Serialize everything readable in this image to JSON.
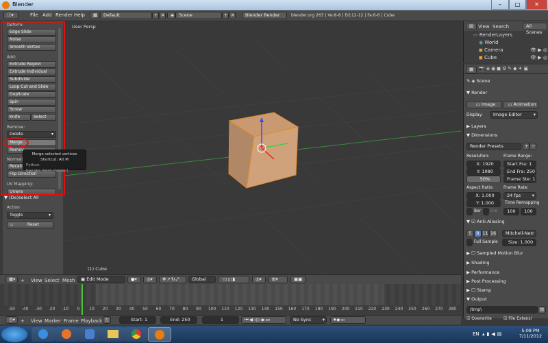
{
  "window": {
    "title": "Blender",
    "min": "–",
    "max": "□",
    "close": "✕"
  },
  "topbar": {
    "menus": [
      "File",
      "Add",
      "Render",
      "Help"
    ],
    "layout": "Default",
    "scene": "Scene",
    "engine": "Blender Render",
    "stats": "blender.org 263 | Ve:8-8 | Ed:12-12 | Fa:6-6 | Cube"
  },
  "toolpanel": {
    "deform_label": "Deform:",
    "deform": [
      "Edge Slide",
      "Noise",
      "Smooth Vertex"
    ],
    "add_label": "Add:",
    "add": [
      "Extrude Region",
      "Extrude Individual",
      "Subdivide",
      "Loop Cut and Slide",
      "Duplicate",
      "Spin",
      "Screw"
    ],
    "knife": "Knife",
    "select": "Select",
    "remove_label": "Remove:",
    "delete": "Delete",
    "merge": "Merge",
    "remove_partial": "Remov",
    "normals_label": "Normals",
    "recalc": "Recalc",
    "flip": "Flip Direction",
    "uv_label": "UV Mapping:",
    "unwrap": "Unwra",
    "deselect_header": "(De)select All",
    "action_label": "Action",
    "action_value": "Toggle",
    "reset": "Reset"
  },
  "tooltip": {
    "line1": "Merge selected vertices",
    "line2": "Shortcut: Alt M",
    "line3": "Python: bpy.ops.mesh.merge()"
  },
  "viewport": {
    "label": "User Persp",
    "object": "(1) Cube"
  },
  "outliner": {
    "view": "View",
    "search": "Search",
    "scenes": "All Scenes",
    "items": [
      "RenderLayers",
      "World",
      "Camera",
      "Cube"
    ]
  },
  "props": {
    "scene": "Scene",
    "render": "Render",
    "image_btn": "Image",
    "anim_btn": "Animation",
    "display_label": "Display:",
    "display_value": "Image Editor",
    "layers": "Layers",
    "dimensions": "Dimensions",
    "presets": "Render Presets",
    "resolution_label": "Resolution:",
    "res_x": "X: 1920",
    "res_y": "Y: 1080",
    "res_pct": "50%",
    "frame_range_label": "Frame Range:",
    "start": "Start Fra: 1",
    "end": "End Fra: 250",
    "step": "Frame Ste: 1",
    "aspect_label": "Aspect Ratio:",
    "asp_x": "X: 1.000",
    "asp_y": "Y: 1.000",
    "framerate_label": "Frame Rate:",
    "fps": "24 fps",
    "remap_label": "Time Remapping",
    "remap_old": "100",
    "remap_new": "100",
    "bor": "Bor",
    "cro": "Cro",
    "aa": "Anti-Aliasing",
    "aa_samples": [
      "5",
      "8",
      "11",
      "16"
    ],
    "aa_filter": "Mitchell-Netr",
    "full_sample": "Full Sample",
    "size": "Size: 1.000",
    "panels": [
      "Sampled Motion Blur",
      "Shading",
      "Performance",
      "Post Processing",
      "Stamp",
      "Output"
    ],
    "output_path": "/tmp\\",
    "overwrite": "Overwrite",
    "file_ext": "File Extensi"
  },
  "vpheader": {
    "view": "View",
    "select": "Select",
    "mesh": "Mesh",
    "mode": "Edit Mode",
    "orient": "Global"
  },
  "timeline": {
    "ticks": [
      "-50",
      "-40",
      "-30",
      "-20",
      "-10",
      "0",
      "10",
      "20",
      "30",
      "40",
      "50",
      "60",
      "70",
      "80",
      "90",
      "100",
      "110",
      "120",
      "130",
      "140",
      "150",
      "160",
      "170",
      "180",
      "190",
      "200",
      "210",
      "220",
      "230",
      "240",
      "250",
      "260",
      "270",
      "280"
    ],
    "view": "View",
    "marker": "Marker",
    "frame": "Frame",
    "playback": "Playback",
    "start": "Start: 1",
    "end": "End: 250",
    "current": "1",
    "sync": "No Sync"
  },
  "taskbar": {
    "lang": "EN",
    "time": "5:08 PM",
    "date": "7/11/2012"
  }
}
